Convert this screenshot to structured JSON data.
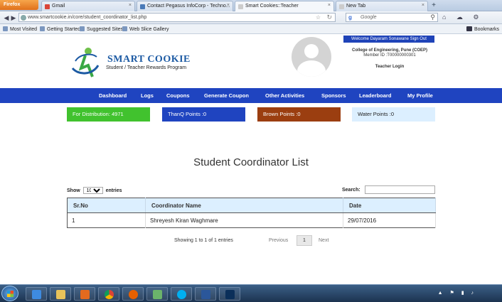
{
  "browser": {
    "menu_button": "Firefox",
    "tabs": [
      {
        "title": "Gmail"
      },
      {
        "title": "Contact Pegasus InfoCorp - Techno..."
      },
      {
        "title": "Smart Cookies::Teacher"
      },
      {
        "title": "New Tab"
      }
    ],
    "url": "www.smartcookie.in/core/student_coordinator_list.php",
    "search_placeholder": "Google",
    "bookmarks": [
      "Most Visited",
      "Getting Started",
      "Suggested Sites",
      "Web Slice Gallery"
    ],
    "bookmarks_menu": "Bookmarks"
  },
  "header": {
    "logo_title": "SMART COOKIE",
    "logo_subtitle": "Student / Teacher Rewards Program",
    "welcome": "Welcome Dayaram Sonawane Sign Out",
    "college": "College of Engineering, Pune (COEP)",
    "member_id": "Member ID :T00000000301",
    "login_type": "Teacher Login"
  },
  "menu": [
    "Dashboard",
    "Logs",
    "Coupons",
    "Generate Coupon",
    "Other Activities",
    "Sponsors",
    "Leaderboard",
    "My Profile"
  ],
  "stats": {
    "distribution": "For Distribution: 4971",
    "thanq": "ThanQ Points :0",
    "brown": "Brown Points :0",
    "water": "Water Points :0"
  },
  "page": {
    "title": "Student Coordinator List",
    "show_label": "Show",
    "entries_value": "10",
    "entries_label": "entries",
    "search_label": "Search:"
  },
  "table": {
    "columns": [
      "Sr.No",
      "Coordinator Name",
      "Date"
    ],
    "rows": [
      [
        "1",
        "Shreyesh Kiran Waghmare",
        "29/07/2016"
      ]
    ]
  },
  "pagination": {
    "info": "Showing 1 to 1 of 1 entries",
    "previous": "Previous",
    "current_page": "1",
    "next": "Next"
  },
  "colors": {
    "menu_bg": "#1f44c0",
    "distribution_bg": "#41c22e",
    "thanq_bg": "#1f44c0",
    "brown_bg": "#9b3e10",
    "water_bg": "#dcefff"
  }
}
